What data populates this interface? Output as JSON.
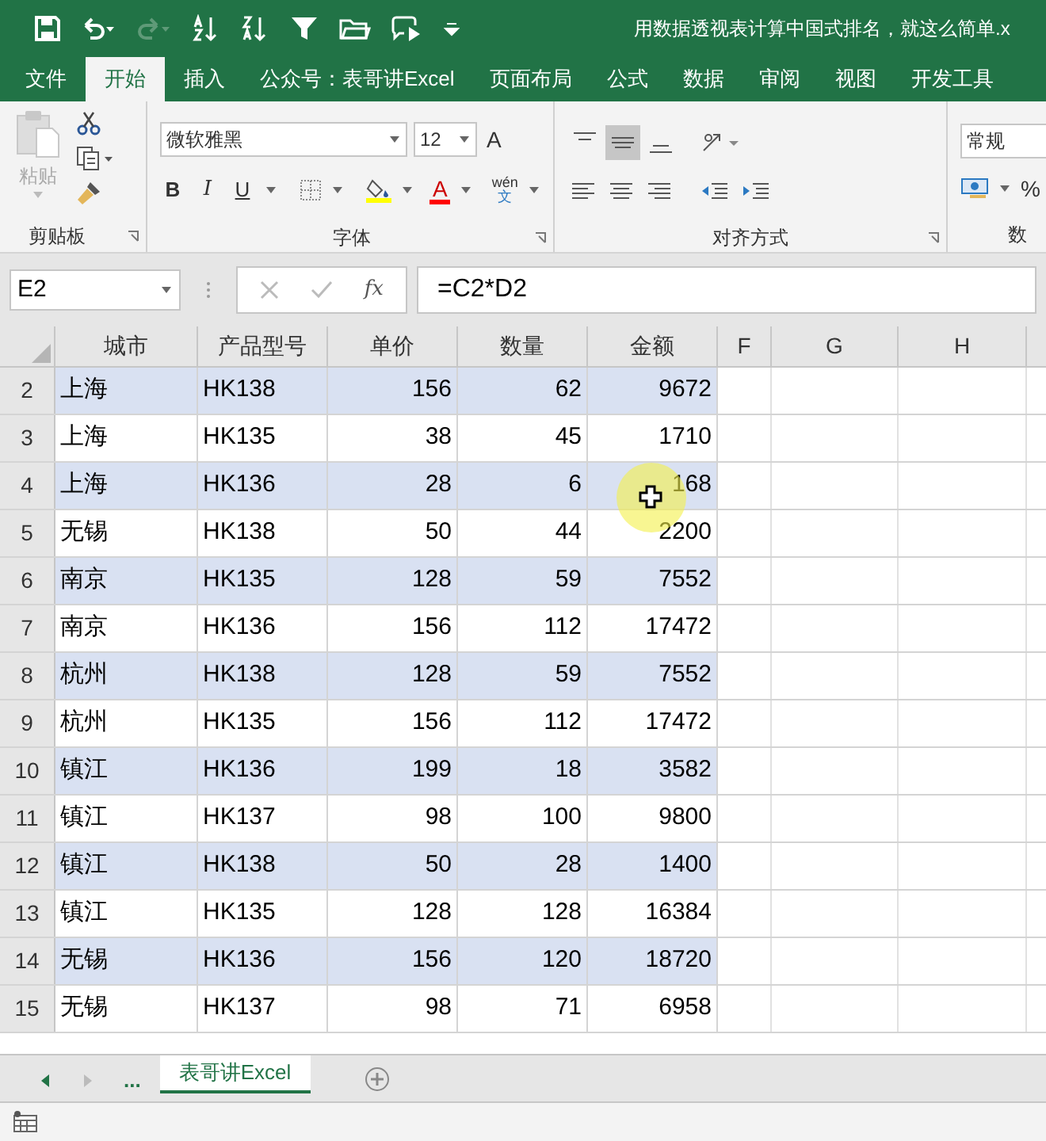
{
  "window": {
    "title": "用数据透视表计算中国式排名，就这么简单.x"
  },
  "ribbon_tabs": [
    {
      "label": "文件",
      "selected": false
    },
    {
      "label": "开始",
      "selected": true
    },
    {
      "label": "插入",
      "selected": false
    },
    {
      "label": "公众号：表哥讲Excel",
      "selected": false
    },
    {
      "label": "页面布局",
      "selected": false
    },
    {
      "label": "公式",
      "selected": false
    },
    {
      "label": "数据",
      "selected": false
    },
    {
      "label": "审阅",
      "selected": false
    },
    {
      "label": "视图",
      "selected": false
    },
    {
      "label": "开发工具",
      "selected": false
    }
  ],
  "clipboard_group": {
    "paste": "粘贴",
    "label": "剪贴板"
  },
  "font_group": {
    "font_name": "微软雅黑",
    "font_size": "12",
    "grow": "A",
    "bold": "B",
    "italic": "I",
    "underline": "U",
    "font_color": "A",
    "phonetic_top": "wén",
    "phonetic_bottom": "文",
    "label": "字体"
  },
  "alignment_group": {
    "label": "对齐方式"
  },
  "number_group": {
    "format": "常规",
    "percent": "%",
    "label": "数"
  },
  "formula_bar": {
    "name_box": "E2",
    "fx": "fx",
    "formula": "=C2*D2"
  },
  "columns": [
    "城市",
    "产品型号",
    "单价",
    "数量",
    "金额",
    "F",
    "G",
    "H"
  ],
  "rows": [
    {
      "number": "2",
      "banded": true,
      "cells": [
        "上海",
        "HK138",
        "156",
        "62",
        "9672"
      ]
    },
    {
      "number": "3",
      "banded": false,
      "cells": [
        "上海",
        "HK135",
        "38",
        "45",
        "1710"
      ]
    },
    {
      "number": "4",
      "banded": true,
      "cells": [
        "上海",
        "HK136",
        "28",
        "6",
        "168"
      ]
    },
    {
      "number": "5",
      "banded": false,
      "cells": [
        "无锡",
        "HK138",
        "50",
        "44",
        "2200"
      ]
    },
    {
      "number": "6",
      "banded": true,
      "cells": [
        "南京",
        "HK135",
        "128",
        "59",
        "7552"
      ]
    },
    {
      "number": "7",
      "banded": false,
      "cells": [
        "南京",
        "HK136",
        "156",
        "112",
        "17472"
      ]
    },
    {
      "number": "8",
      "banded": true,
      "cells": [
        "杭州",
        "HK138",
        "128",
        "59",
        "7552"
      ]
    },
    {
      "number": "9",
      "banded": false,
      "cells": [
        "杭州",
        "HK135",
        "156",
        "112",
        "17472"
      ]
    },
    {
      "number": "10",
      "banded": true,
      "cells": [
        "镇江",
        "HK136",
        "199",
        "18",
        "3582"
      ]
    },
    {
      "number": "11",
      "banded": false,
      "cells": [
        "镇江",
        "HK137",
        "98",
        "100",
        "9800"
      ]
    },
    {
      "number": "12",
      "banded": true,
      "cells": [
        "镇江",
        "HK138",
        "50",
        "28",
        "1400"
      ]
    },
    {
      "number": "13",
      "banded": false,
      "cells": [
        "镇江",
        "HK135",
        "128",
        "128",
        "16384"
      ]
    },
    {
      "number": "14",
      "banded": true,
      "cells": [
        "无锡",
        "HK136",
        "156",
        "120",
        "18720"
      ]
    },
    {
      "number": "15",
      "banded": false,
      "cells": [
        "无锡",
        "HK137",
        "98",
        "71",
        "6958"
      ]
    }
  ],
  "sheet_nav": {
    "more": "..."
  },
  "sheet_tabs": [
    {
      "label": "表哥讲Excel",
      "selected": true
    }
  ]
}
